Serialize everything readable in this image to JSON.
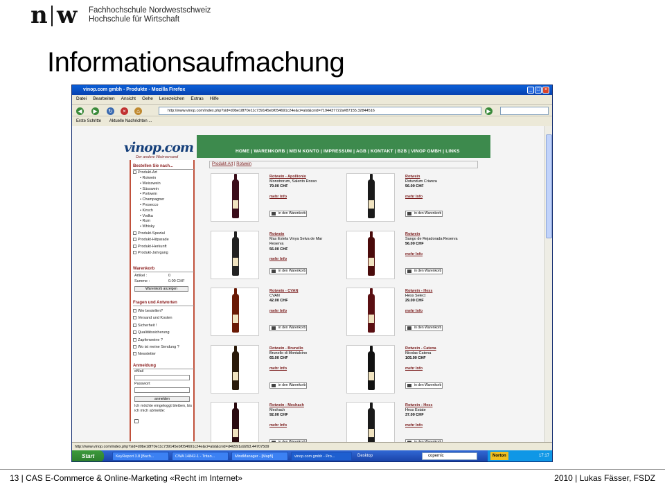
{
  "header": {
    "logo_n": "n",
    "logo_w": "w",
    "school_line1": "Fachhochschule Nordwestschweiz",
    "school_line2": "Hochschule für Wirtschaft"
  },
  "slide_title": "Informationsaufmachung",
  "browser": {
    "window_title": "vinop.com gmbh - Produkte - Mozilla Firefox",
    "menu": [
      "Datei",
      "Bearbeiten",
      "Ansicht",
      "Gehe",
      "Lesezeichen",
      "Extras",
      "Hilfe"
    ],
    "url": "http://www.vinop.com/index.php?sid=d0be18f70e11c739145ebf054691c24e&ci=alst&cnid=7194437722a#87155.32844516",
    "bookmarks": [
      "Erste Schritte",
      "Aktuelle Nachrichten ..."
    ],
    "status_url": "http://www.vinop.com/index.php?sid=d0be18f70e11c739145ebf054691c24e&ci=alst&cnid=d46591a9263.44707509",
    "taskbar": {
      "start": "Start",
      "tasks": [
        "KeyReport 3.8 [Bach...",
        "CWA 14842-1 - Tritan...",
        "MindManager - [Map5]",
        "vinop.com gmbh - Pro..."
      ],
      "desktop": "Desktop",
      "search": "copernic",
      "tray_label": "Norton",
      "clock": "17:17"
    }
  },
  "shop": {
    "logo": "vinop.com",
    "slogan": "Der andere Weinversand",
    "nav": [
      "HOME",
      "WARENKORB",
      "MEIN KONTO",
      "IMPRESSUM",
      "AGB",
      "KONTAKT",
      "B2B",
      "VINOP GMBH",
      "LINKS"
    ],
    "sidebar": {
      "order_head": "Bestellen Sie nach...",
      "product_art": "Produkt-Art",
      "categories": [
        "Rotwein",
        "Weisswein",
        "Süsswein",
        "Portwein",
        "Champagner",
        "Prosecco",
        "Kirsch",
        "Vodka",
        "Rum",
        "Whisky"
      ],
      "others": [
        "Produkt-Spezial",
        "Produkt-Hitparade",
        "Produkt-Herkunft",
        "Produkt-Jahrgang"
      ],
      "cart_head": "Warenkorb",
      "cart_items_label": "Artikel :",
      "cart_items_value": "0",
      "cart_sum_label": "Summe :",
      "cart_sum_value": "0.00 CHF",
      "cart_btn": "Warenkorb anzeigen",
      "faq_head": "Fragen und Antworten",
      "faq": [
        "Wie bestellen?",
        "Versand und Kosten",
        "Sicherheit !",
        "Qualitätssicherung",
        "Zapfenweine ?",
        "Wo ist meine Sendung ?",
        "Newsletter"
      ],
      "login_head": "Anmeldung",
      "email_label": "eMail",
      "password_label": "Passwort",
      "login_btn": "anmelden",
      "remember": "Ich möchte eingeloggt bleiben, bis ich mich abmelde:"
    },
    "breadcrumb": {
      "part1": "Produkt-Art",
      "sep": " | ",
      "part2": "Rotwein"
    },
    "cart_button": "in den Warenkorb",
    "more": "mehr Info",
    "products": [
      {
        "cat": "Rotwein - Apollionio",
        "name": "Monstrorum, Salento Rosso",
        "price": "79.00 CHF",
        "color": "#3a0d1a"
      },
      {
        "cat": "Rotwein",
        "name": "Rotundum Crianza",
        "price": "56.00 CHF",
        "color": "#1a1a1a"
      },
      {
        "cat": "Rotwein",
        "name": "Mas Estela Vinya Selva de Mar",
        "name2": "Reserva",
        "price": "56.00 CHF",
        "color": "#222"
      },
      {
        "cat": "Rotwein",
        "name": "Sango de Rejadorada Reserva",
        "price": "56.00 CHF",
        "color": "#4a0a0a"
      },
      {
        "cat": "Rotwein - CVAN",
        "name": "CVAN",
        "price": "42.00 CHF",
        "color": "#6a1a05"
      },
      {
        "cat": "Rotwein - Hess",
        "name": "Hess Select",
        "price": "29.00 CHF",
        "color": "#5a0f12"
      },
      {
        "cat": "Rotwein - Brunello",
        "name": "Brunello di Montalcino",
        "price": "65.00 CHF",
        "color": "#2a1a0a"
      },
      {
        "cat": "Rotwein - Catena",
        "name": "Nicolas Catena",
        "price": "105.00 CHF",
        "color": "#111"
      },
      {
        "cat": "Rotwein - Meshach",
        "name": "Meshach",
        "price": "92.00 CHF",
        "color": "#2a0a10"
      },
      {
        "cat": "Rotwein - Hess",
        "name": "Hess Estate",
        "price": "37.00 CHF",
        "color": "#1a1a1a"
      }
    ]
  },
  "footer": {
    "left": "13 | CAS E-Commerce & Online-Marketing «Recht im Internet»",
    "right": "2010 | Lukas Fässer, FSDZ"
  }
}
